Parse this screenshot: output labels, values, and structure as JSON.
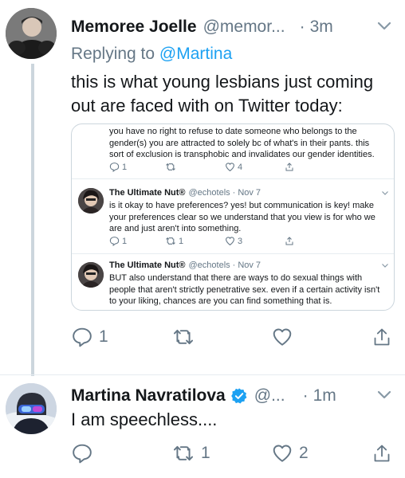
{
  "tweet1": {
    "name": "Memoree Joelle",
    "handle": "@memor...",
    "dot": "·",
    "time": "3m",
    "replying_prefix": "Replying to",
    "replying_to": "@Martina",
    "text": "this is what young lesbians just coming out are faced with on Twitter today:",
    "reply_count": "1",
    "retweet_count": "",
    "like_count": ""
  },
  "embed": {
    "top_text": "you have no right to refuse to date someone who belongs to the gender(s) you are attracted to solely bc of what's in their pants. this sort of exclusion is transphobic and invalidates our gender identities.",
    "top_stats": {
      "replies": "1",
      "retweets": "",
      "likes": "4"
    },
    "tweets": [
      {
        "name": "The Ultimate Nut®",
        "handle": "@echotels",
        "dot": "·",
        "date": "Nov 7",
        "text": "is it okay to have preferences? yes! but communication is key! make your preferences clear so we understand that you view is for who we are and just aren't into something.",
        "replies": "1",
        "retweets": "1",
        "likes": "3"
      },
      {
        "name": "The Ultimate Nut®",
        "handle": "@echotels",
        "dot": "·",
        "date": "Nov 7",
        "text": "BUT also understand that there are ways to do sexual things with people that aren't strictly penetrative sex. even if a certain activity isn't to your liking, chances are you can find something that is."
      }
    ]
  },
  "tweet2": {
    "name": "Martina Navratilova",
    "handle": "@...",
    "dot": "·",
    "time": "1m",
    "text": "I am speechless....",
    "reply_count": "",
    "retweet_count": "1",
    "like_count": "2"
  },
  "colors": {
    "accent": "#1da1f2",
    "text": "#14171a",
    "secondary": "#657786",
    "border": "#ccd6dd"
  }
}
